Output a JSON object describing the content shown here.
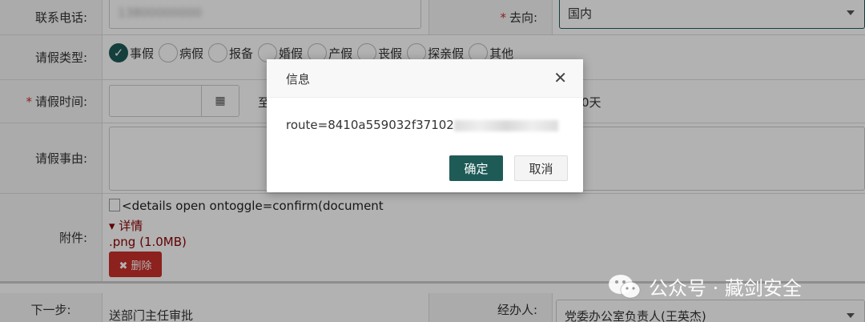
{
  "form": {
    "phone_label": "联系电话:",
    "phone_value": "13800000000",
    "destination_label": "去向:",
    "destination_value": "国内",
    "leave_type_label": "请假类型:",
    "leave_types": [
      "事假",
      "病假",
      "报备",
      "婚假",
      "产假",
      "丧假",
      "探亲假",
      "其他"
    ],
    "leave_time_label": "请假时间:",
    "leave_time_to": "至",
    "leave_days_suffix": "0天",
    "reason_label": "请假事由:",
    "attachment_label": "附件:",
    "attachment_line1": "<details open ontoggle=confirm(document",
    "attachment_line2": "▾ 详情",
    "attachment_line3": ".png (1.0MB)",
    "delete_label": "✖ 删除",
    "next_step_label": "下一步:",
    "next_step_value": "送部门主任审批",
    "handler_label": "经办人:",
    "handler_value": "党委办公室负责人(王英杰)"
  },
  "dialog": {
    "title": "信息",
    "close": "✕",
    "message": "route=8410a559032f37102",
    "ok_label": "确定",
    "cancel_label": "取消"
  },
  "watermark": {
    "text": "公众号 · 藏剑安全"
  },
  "colors": {
    "primary": "#1e5b57",
    "danger": "#c9302c",
    "required": "#c9302c"
  }
}
